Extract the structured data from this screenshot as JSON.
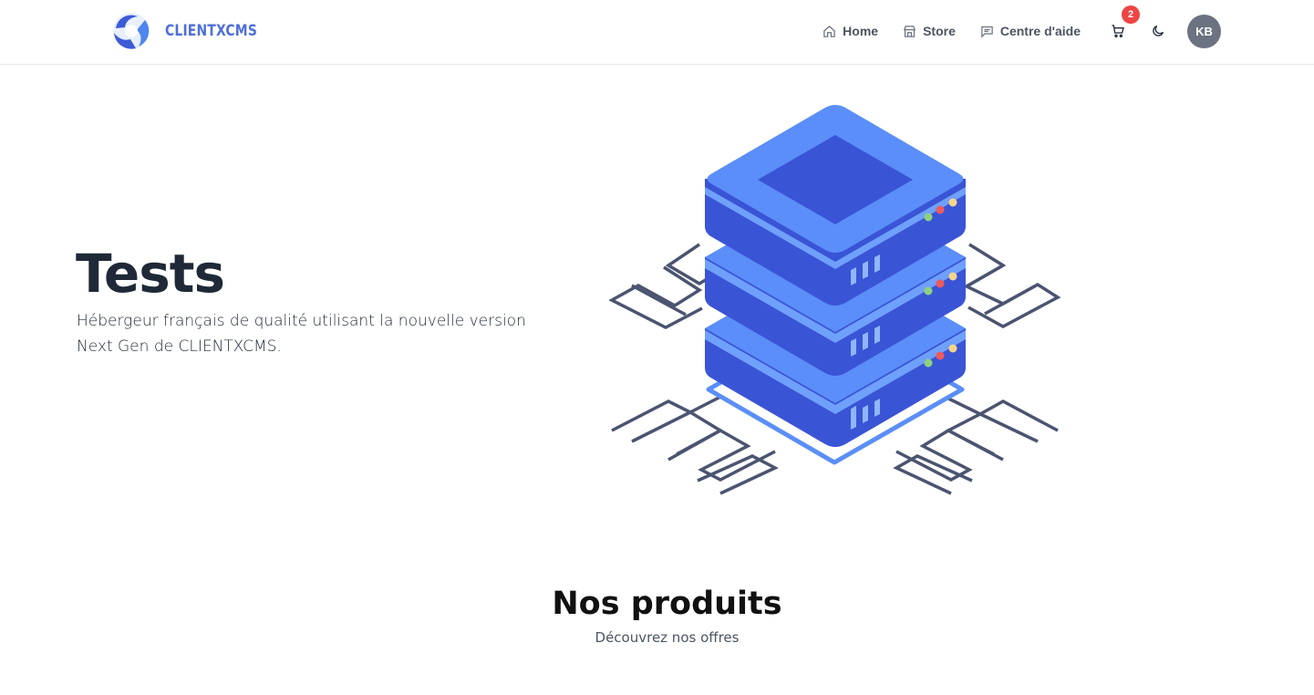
{
  "header": {
    "brand": "CLIENTXCMS",
    "nav": {
      "home": "Home",
      "store": "Store",
      "help": "Centre d'aide"
    },
    "cart_count": "2",
    "user_initials": "KB"
  },
  "hero": {
    "title": "Tests",
    "description": "Hébergeur français de qualité utilisant la nouvelle version Next Gen de CLIENTXCMS."
  },
  "products_section": {
    "title": "Nos produits",
    "subtitle": "Découvrez nos offres"
  },
  "colors": {
    "brand": "#4f6fd8",
    "badge": "#ef4444",
    "avatar": "#6b7280",
    "server_top": "#5b8ef8",
    "server_body": "#3a54d6"
  }
}
